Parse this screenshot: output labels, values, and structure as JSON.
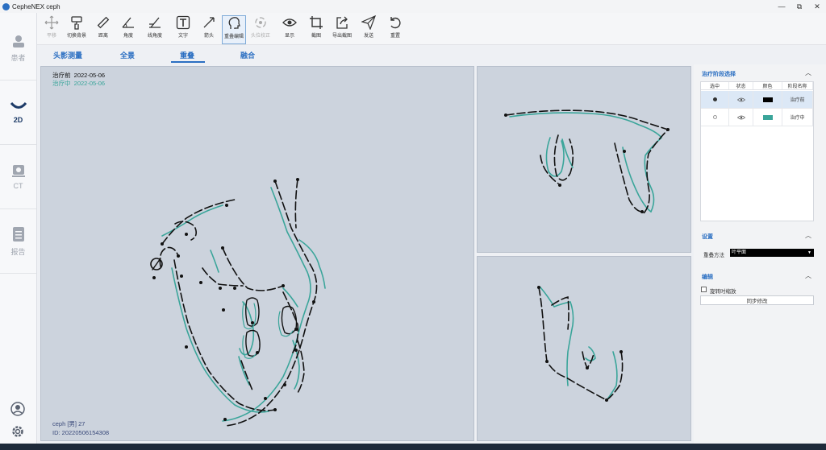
{
  "app": {
    "title": "CepheNEX  ceph"
  },
  "window_controls": {
    "minimize": "—",
    "restore": "⧉",
    "close": "✕"
  },
  "nav": {
    "patient": "患者",
    "twod": "2D",
    "ct": "CT",
    "report": "报告"
  },
  "toolbar": {
    "pan": "平移",
    "switch_bg": "切换背景",
    "distance": "距离",
    "angle": "角度",
    "line_angle": "线角度",
    "text": "文字",
    "arrow": "箭头",
    "overlay_edit": "重叠编辑",
    "head_correct": "头位校正",
    "display": "显示",
    "screenshot": "截图",
    "export": "导出截图",
    "send": "发送",
    "reset": "重置"
  },
  "tabs": {
    "ceph": "头影测量",
    "panorama": "全景",
    "overlay": "重叠",
    "fusion": "融合"
  },
  "main_view": {
    "stage1_label": "治疗前",
    "stage1_date": "2022-05-06",
    "stage2_label": "治疗中",
    "stage2_date": "2022-05-06",
    "patient_line": "ceph [男] 27",
    "id_line": "ID: 20220506154308"
  },
  "right_panel": {
    "stage_section": "治疗阶段选择",
    "columns": [
      "选中",
      "状态",
      "颜色",
      "阶段名称"
    ],
    "rows": [
      {
        "name": "治疗前",
        "color": "#000000",
        "selected": true
      },
      {
        "name": "治疗中",
        "color": "#3aa59a",
        "selected": false
      }
    ],
    "settings_section": "设置",
    "overlay_method_label": "重叠方法",
    "overlay_method_value": "叶平面",
    "edit_section": "编辑",
    "rotate_scale_label": "旋转时缩放",
    "sync_button": "同步修改"
  },
  "colors": {
    "accent": "#2b6fc2",
    "stage1": "#111111",
    "stage2": "#3aa59a",
    "canvas": "#ccd3dd"
  }
}
